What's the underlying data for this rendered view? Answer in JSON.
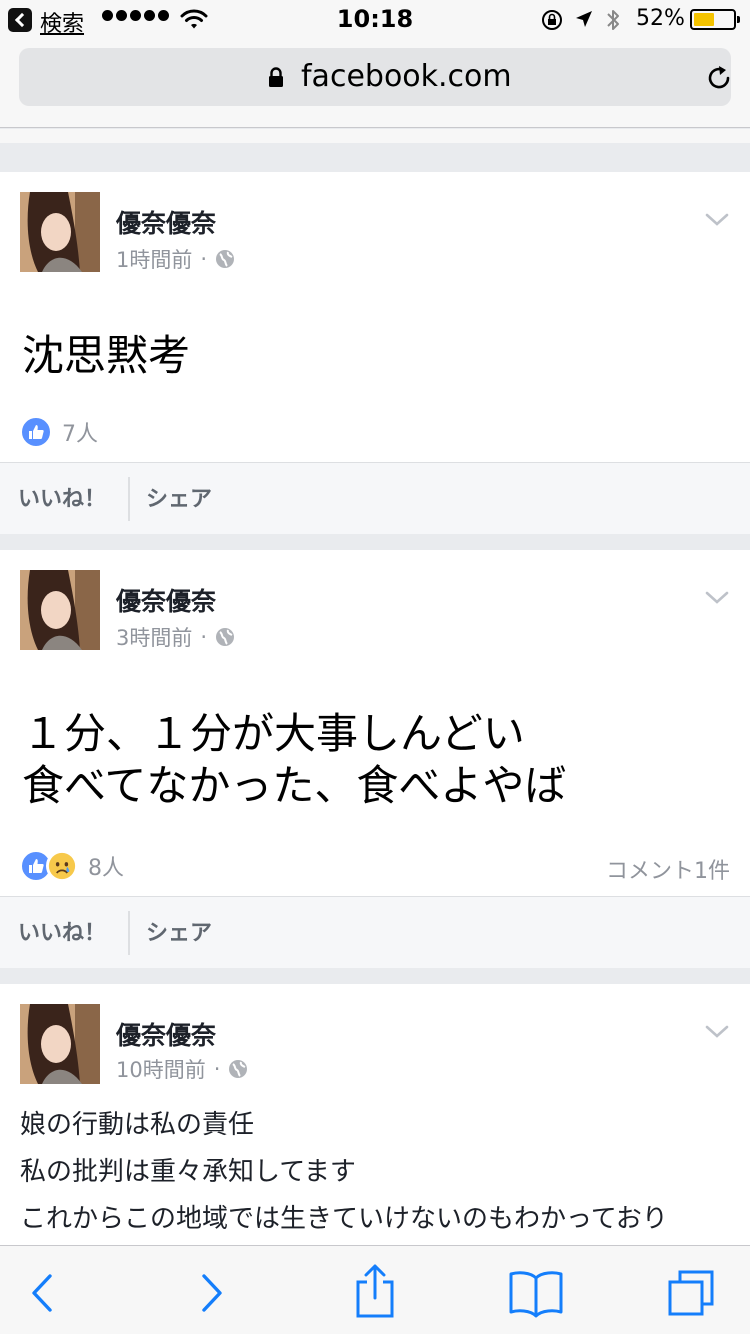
{
  "status_bar": {
    "back_label": "検索",
    "time": "10:18",
    "battery_pct": "52%",
    "battery_level": 0.52,
    "icons": [
      "back-app-icon",
      "signal-dots-icon",
      "wifi-icon",
      "orientation-lock-icon",
      "location-arrow-icon",
      "bluetooth-icon",
      "battery-icon"
    ]
  },
  "address_bar": {
    "url": "facebook.com",
    "icons": [
      "lock-icon",
      "reload-icon"
    ]
  },
  "colors": {
    "like_blue": "#5890ff",
    "battery_yellow": "#f4c300",
    "ios_blue": "#147efb",
    "feed_gray": "#e9ebee"
  },
  "posts": [
    {
      "author": "優奈優奈",
      "time": "1時間前",
      "separator": "·",
      "text_lines": [
        "沈思黙考"
      ],
      "reaction_count": "7人",
      "reactions": [
        "like"
      ],
      "like_label": "いいね！",
      "share_label": "シェア"
    },
    {
      "author": "優奈優奈",
      "time": "3時間前",
      "separator": "·",
      "text_lines": [
        "１分、１分が大事しんどい",
        "食べてなかった、食べよやば"
      ],
      "reaction_count": "8人",
      "reactions": [
        "like",
        "sad"
      ],
      "comments": "コメント1件",
      "like_label": "いいね！",
      "share_label": "シェア"
    },
    {
      "author": "優奈優奈",
      "time": "10時間前",
      "separator": "·",
      "text_lines": [
        "娘の行動は私の責任",
        "私の批判は重々承知してます",
        "これからこの地域では生きていけないのもわかっており"
      ]
    }
  ],
  "toolbar": {
    "icons": [
      "back-arrow-icon",
      "forward-arrow-icon",
      "share-icon",
      "bookmarks-icon",
      "tabs-icon"
    ]
  }
}
